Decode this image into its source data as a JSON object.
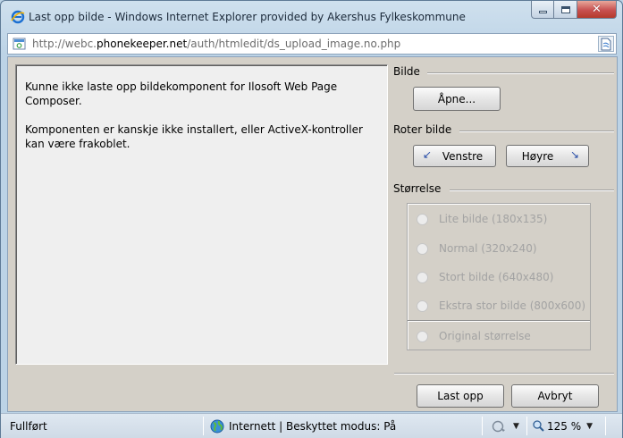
{
  "window": {
    "title": "Last opp bilde - Windows Internet Explorer provided by Akershus Fylkeskommune",
    "minimize_glyph": "",
    "close_glyph": "✕"
  },
  "address": {
    "prefix": "http://webc.",
    "domain": "phonekeeper.net",
    "path": "/auth/htmledit/ds_upload_image.no.php"
  },
  "message": {
    "line1": "Kunne ikke laste opp bildekomponent for Ilosoft Web Page Composer.",
    "line2": "Komponenten er kanskje ikke installert, eller ActiveX-kontroller kan være frakoblet."
  },
  "bilde": {
    "label": "Bilde",
    "open_button": "Åpne..."
  },
  "rotate": {
    "label": "Roter bilde",
    "left_button": "Venstre",
    "right_button": "Høyre"
  },
  "size": {
    "label": "Størrelse",
    "options": [
      "Lite bilde (180x135)",
      "Normal (320x240)",
      "Stort bilde (640x480)",
      "Ekstra stor bilde (800x600)"
    ],
    "original": "Original størrelse"
  },
  "actions": {
    "upload": "Last opp",
    "cancel": "Avbryt"
  },
  "status": {
    "done": "Fullført",
    "zone": "Internett | Beskyttet modus: På",
    "zoom": "125 %"
  },
  "colors": {
    "accent": "#2a4fa8",
    "disabled_text": "#a3a3a3"
  },
  "icons": [
    "ie-icon",
    "page-icon",
    "globe-icon",
    "security-icon",
    "zoom-icon",
    "rotate-left-icon",
    "rotate-right-icon"
  ]
}
